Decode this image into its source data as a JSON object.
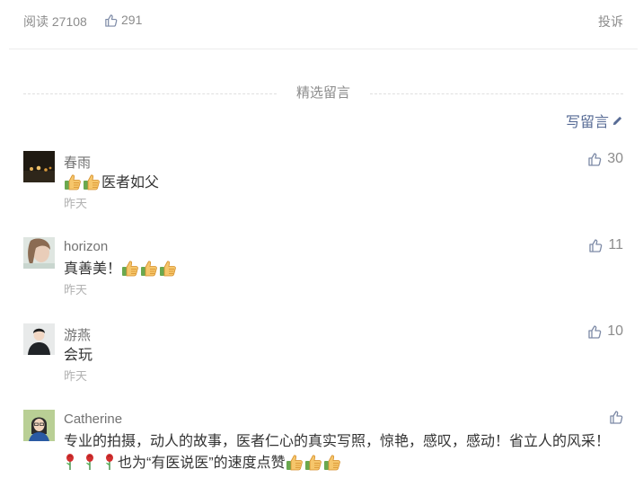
{
  "header": {
    "read_label": "阅读 27108",
    "like_count": "291",
    "report_label": "投诉"
  },
  "section_title": "精选留言",
  "write_comment_label": "写留言",
  "comments": [
    {
      "name": "春雨",
      "text": "医者如父",
      "time": "昨天",
      "likes": "30"
    },
    {
      "name": "horizon",
      "text": "真善美！",
      "time": "昨天",
      "likes": "11"
    },
    {
      "name": "游燕",
      "text": "会玩",
      "time": "昨天",
      "likes": "10"
    },
    {
      "name": "Catherine",
      "text_line1": "专业的拍摄，动人的故事，医者仁心的真实写照，惊艳，感叹，感动！省立人的风采！",
      "text_line2": "也为“有医说医”的速度点赞",
      "likes": ""
    }
  ],
  "icons": {
    "thumb": "thumbs-up-icon",
    "pencil": "pencil-icon",
    "emoji_thumb": "thumbs-up-emoji",
    "rose": "rose-emoji"
  },
  "colors": {
    "link": "#576b95",
    "muted": "#8c8c8c"
  }
}
